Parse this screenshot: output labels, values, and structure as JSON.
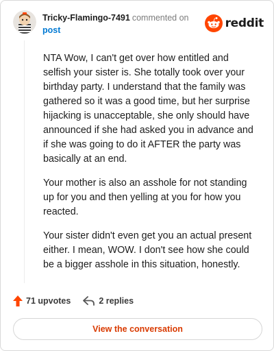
{
  "header": {
    "username": "Tricky-Flamingo-7491",
    "commented_on": "commented on",
    "post_link": "post",
    "brand": "reddit"
  },
  "comment": {
    "paragraphs": [
      "NTA Wow, I can't get over how entitled and selfish your sister is. She totally took over your birthday party. I understand that the family was gathered so it was a good time, but her surprise hijacking is unacceptable, she only should have announced if she had asked you in advance and if she was going to do it AFTER the party was basically at an end.",
      "Your mother is also an asshole for not standing up for you and then yelling at you for how you reacted.",
      "Your sister didn't even get you an actual present either. I mean, WOW. I don't see how she could be a bigger asshole in this situation, honestly."
    ]
  },
  "actions": {
    "upvotes": "71 upvotes",
    "replies": "2 replies"
  },
  "cta": {
    "label": "View the conversation"
  },
  "colors": {
    "brand_orange": "#ff4500",
    "link_blue": "#0079d3",
    "cta_text": "#d93a00"
  }
}
